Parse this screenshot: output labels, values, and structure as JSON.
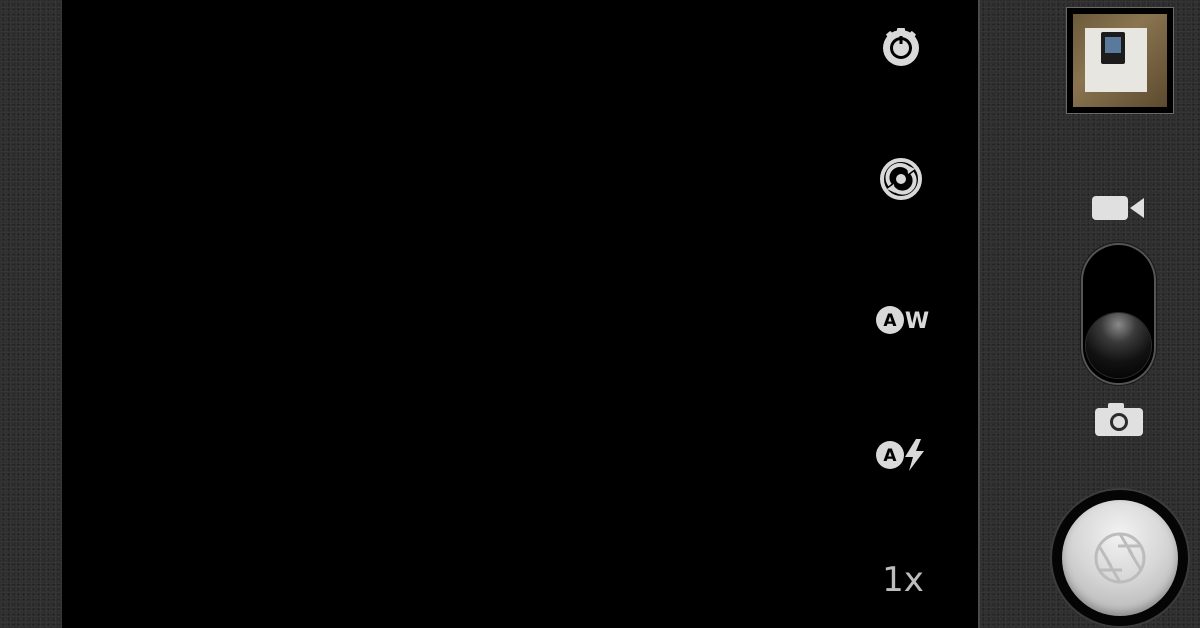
{
  "app": {
    "name": "Camera"
  },
  "settings_bar": {
    "items": [
      {
        "name": "camera-settings",
        "icon": "gear-icon"
      },
      {
        "name": "switch-camera",
        "icon": "switch-camera-icon"
      },
      {
        "name": "white-balance",
        "icon": "white-balance-auto-icon",
        "text": "AW"
      },
      {
        "name": "flash-mode",
        "icon": "flash-auto-icon",
        "text": "A"
      }
    ],
    "zoom_label": "1x"
  },
  "side_panel": {
    "thumbnail": {
      "icon": "last-photo-thumbnail"
    },
    "mode_switch": {
      "video_icon": "video-camera-icon",
      "photo_icon": "photo-camera-icon",
      "selected_mode": "photo"
    },
    "shutter": {
      "icon": "shutter-aperture-icon"
    }
  },
  "colors": {
    "viewfinder": "#000000",
    "panel_texture": "#2c2c2c",
    "icon_light": "#d9d9d9",
    "zoom_text": "#bdbdbd",
    "shutter_face": "#d7d7d7"
  }
}
